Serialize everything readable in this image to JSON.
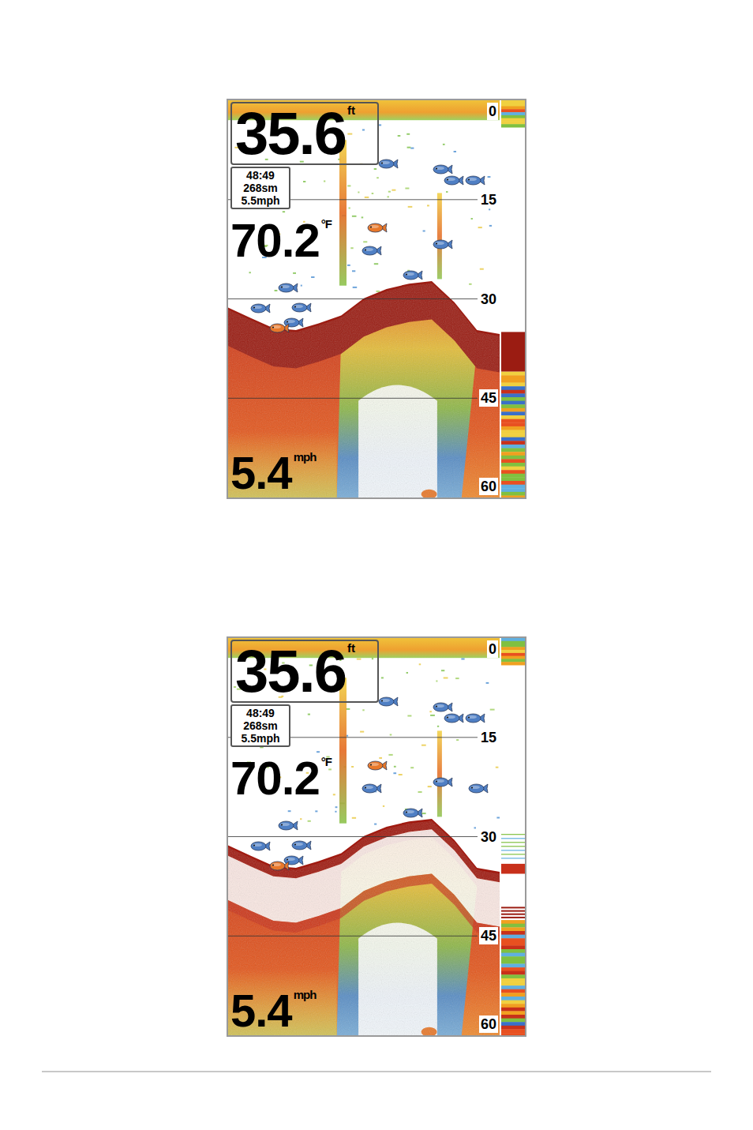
{
  "screens": [
    {
      "depth": "35.6",
      "depth_unit": "ft",
      "info": [
        "48:49",
        "268sm",
        "5.5mph"
      ],
      "temperature": "70.2",
      "temperature_unit": "°F",
      "speed": "5.4",
      "speed_unit": "mph",
      "scale": [
        "0",
        "15",
        "30",
        "45",
        "60"
      ],
      "whiteline": false,
      "bottom": [
        31.6,
        33.2,
        34.7,
        35.0,
        34.0,
        32.8,
        30.2,
        28.8,
        28.0,
        27.6,
        30.8,
        35.0,
        35.6
      ],
      "fish": [
        {
          "x": 0.59,
          "depth": 9.5,
          "color": "#4f7fc4"
        },
        {
          "x": 0.79,
          "depth": 10.4,
          "color": "#4f7fc4"
        },
        {
          "x": 0.83,
          "depth": 12.0,
          "color": "#4f7fc4"
        },
        {
          "x": 0.91,
          "depth": 12.0,
          "color": "#4f7fc4"
        },
        {
          "x": 0.55,
          "depth": 19.2,
          "color": "#e8782a"
        },
        {
          "x": 0.53,
          "depth": 22.7,
          "color": "#4f7fc4"
        },
        {
          "x": 0.79,
          "depth": 21.7,
          "color": "#4f7fc4"
        },
        {
          "x": 0.68,
          "depth": 26.3,
          "color": "#4f7fc4"
        },
        {
          "x": 0.22,
          "depth": 28.3,
          "color": "#4f7fc4"
        },
        {
          "x": 0.12,
          "depth": 31.4,
          "color": "#4f7fc4"
        },
        {
          "x": 0.27,
          "depth": 31.3,
          "color": "#4f7fc4"
        },
        {
          "x": 0.24,
          "depth": 33.5,
          "color": "#4f7fc4"
        },
        {
          "x": 0.19,
          "depth": 34.4,
          "color": "#e8782a"
        }
      ]
    },
    {
      "depth": "35.6",
      "depth_unit": "ft",
      "info": [
        "48:49",
        "268sm",
        "5.5mph"
      ],
      "temperature": "70.2",
      "temperature_unit": "°F",
      "speed": "5.4",
      "speed_unit": "mph",
      "scale": [
        "0",
        "15",
        "30",
        "45",
        "60"
      ],
      "whiteline": true,
      "bottom": [
        31.6,
        33.2,
        34.7,
        35.0,
        34.0,
        32.8,
        30.2,
        28.8,
        28.0,
        27.6,
        30.8,
        35.0,
        35.6
      ],
      "fish": [
        {
          "x": 0.59,
          "depth": 9.5,
          "color": "#4f7fc4"
        },
        {
          "x": 0.79,
          "depth": 10.4,
          "color": "#4f7fc4"
        },
        {
          "x": 0.83,
          "depth": 12.0,
          "color": "#4f7fc4"
        },
        {
          "x": 0.91,
          "depth": 12.0,
          "color": "#4f7fc4"
        },
        {
          "x": 0.55,
          "depth": 19.2,
          "color": "#e8782a"
        },
        {
          "x": 0.53,
          "depth": 22.7,
          "color": "#4f7fc4"
        },
        {
          "x": 0.79,
          "depth": 21.7,
          "color": "#4f7fc4"
        },
        {
          "x": 0.92,
          "depth": 22.6,
          "color": "#4f7fc4"
        },
        {
          "x": 0.68,
          "depth": 26.3,
          "color": "#4f7fc4"
        },
        {
          "x": 0.22,
          "depth": 28.3,
          "color": "#4f7fc4"
        },
        {
          "x": 0.12,
          "depth": 31.4,
          "color": "#4f7fc4"
        },
        {
          "x": 0.27,
          "depth": 31.3,
          "color": "#4f7fc4"
        },
        {
          "x": 0.24,
          "depth": 33.5,
          "color": "#4f7fc4"
        },
        {
          "x": 0.19,
          "depth": 34.4,
          "color": "#e8782a"
        }
      ]
    }
  ]
}
